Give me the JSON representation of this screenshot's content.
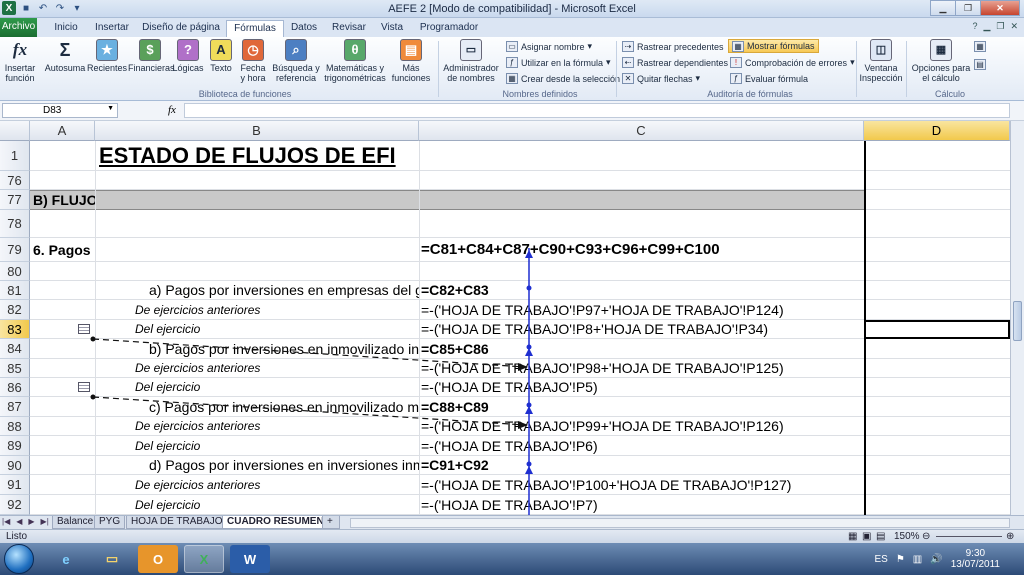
{
  "window": {
    "title": "AEFE 2  [Modo de compatibilidad] - Microsoft Excel"
  },
  "tabs": {
    "file": "Archivo",
    "items": [
      "Inicio",
      "Insertar",
      "Diseño de página",
      "Fórmulas",
      "Datos",
      "Revisar",
      "Vista",
      "Programador"
    ],
    "active": "Fórmulas"
  },
  "ribbon": {
    "insert_function": "Insertar función",
    "autosum": "Autosuma",
    "recent": "Recientes",
    "financial": "Financieras",
    "logical": "Lógicas",
    "text": "Texto",
    "datetime": "Fecha y hora",
    "lookup": "Búsqueda y referencia",
    "math": "Matemáticas y trigonométricas",
    "more": "Más funciones",
    "name_manager": "Administrador de nombres",
    "define_name": "Asignar nombre",
    "use_in_formula": "Utilizar en la fórmula",
    "create_from_selection": "Crear desde la selección",
    "trace_precedents": "Rastrear precedentes",
    "trace_dependents": "Rastrear dependientes",
    "remove_arrows": "Quitar flechas",
    "show_formulas": "Mostrar fórmulas",
    "error_checking": "Comprobación de errores",
    "evaluate_formula": "Evaluar fórmula",
    "watch_window": "Ventana Inspección",
    "calc_options": "Opciones para el cálculo",
    "group_library": "Biblioteca de funciones",
    "group_names": "Nombres definidos",
    "group_audit": "Auditoría de fórmulas",
    "group_calc": "Cálculo"
  },
  "formula_bar": {
    "name_box": "D83",
    "fx": "fx",
    "content": ""
  },
  "columns": [
    "A",
    "B",
    "C",
    "D"
  ],
  "rows": [
    {
      "num": "1",
      "a": "",
      "b": "ESTADO DE FLUJOS DE EFI",
      "c": ""
    },
    {
      "num": "76",
      "a": "",
      "b": "",
      "c": ""
    },
    {
      "num": "77",
      "a": "B) FLUJO",
      "b": "",
      "c": ""
    },
    {
      "num": "78",
      "a": "",
      "b": "",
      "c": ""
    },
    {
      "num": "79",
      "a": "6. Pagos",
      "b": "",
      "c": "=C81+C84+C87+C90+C93+C96+C99+C100"
    },
    {
      "num": "80",
      "a": "",
      "b": "",
      "c": ""
    },
    {
      "num": "81",
      "a": "",
      "b": "a) Pagos por inversiones en empresas del grupo y a",
      "c": "=C82+C83"
    },
    {
      "num": "82",
      "a": "",
      "b": "De ejercicios anteriores",
      "c": "=-('HOJA DE TRABAJO'!P97+'HOJA DE TRABAJO'!P124)"
    },
    {
      "num": "83",
      "a": "",
      "b": "Del ejercicio",
      "c": "=-('HOJA DE TRABAJO'!P8+'HOJA DE TRABAJO'!P34)"
    },
    {
      "num": "84",
      "a": "",
      "b": "b) Pagos por inversiones en inmovilizado intangible (",
      "c": "=C85+C86"
    },
    {
      "num": "85",
      "a": "",
      "b": "De ejercicios anteriores",
      "c": "=-('HOJA DE TRABAJO'!P98+'HOJA DE TRABAJO'!P125)"
    },
    {
      "num": "86",
      "a": "",
      "b": "Del ejercicio",
      "c": "=-('HOJA DE TRABAJO'!P5)"
    },
    {
      "num": "87",
      "a": "",
      "b": "c) Pagos por inversiones en inmovilizado material (-",
      "c": "=C88+C89"
    },
    {
      "num": "88",
      "a": "",
      "b": "De ejercicios anteriores",
      "c": "=-('HOJA DE TRABAJO'!P99+'HOJA DE TRABAJO'!P126)"
    },
    {
      "num": "89",
      "a": "",
      "b": "Del ejercicio",
      "c": "=-('HOJA DE TRABAJO'!P6)"
    },
    {
      "num": "90",
      "a": "",
      "b": "d) Pagos por inversiones en inversiones inmobiliaria",
      "c": "=C91+C92"
    },
    {
      "num": "91",
      "a": "",
      "b": "De ejercicios anteriores",
      "c": "=-('HOJA DE TRABAJO'!P100+'HOJA DE TRABAJO'!P127)"
    },
    {
      "num": "92",
      "a": "",
      "b": "Del ejercicio",
      "c": "=-('HOJA DE TRABAJO'!P7)"
    }
  ],
  "sheets": [
    "Balance",
    "PYG",
    "HOJA DE TRABAJO",
    "CUADRO RESUMEN"
  ],
  "active_sheet": "CUADRO RESUMEN",
  "status": {
    "mode": "Listo",
    "zoom": "150%"
  },
  "tray": {
    "lang": "ES",
    "time": "9:30",
    "date": "13/07/2011"
  },
  "colors": {
    "accent": "#2a6ebb",
    "selection": "#f2c94c",
    "file_tab": "#1f7a3a",
    "arrow": "#1f2fd0"
  }
}
